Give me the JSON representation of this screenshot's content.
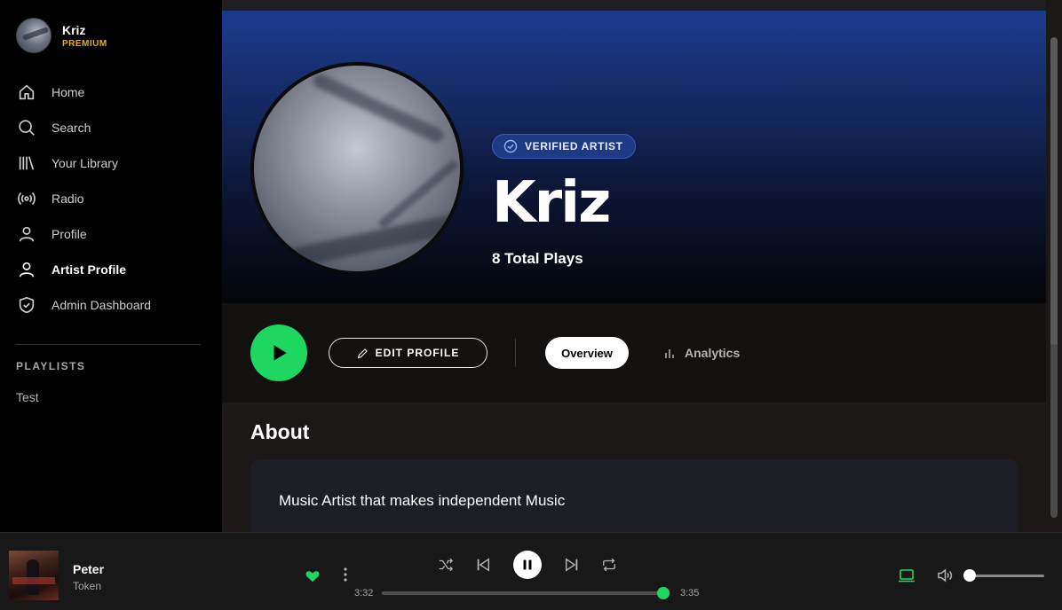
{
  "user": {
    "name": "Kriz",
    "tier": "PREMIUM"
  },
  "nav": [
    {
      "label": "Home",
      "icon": "home-icon",
      "active": false
    },
    {
      "label": "Search",
      "icon": "search-icon",
      "active": false
    },
    {
      "label": "Your Library",
      "icon": "library-icon",
      "active": false
    },
    {
      "label": "Radio",
      "icon": "radio-icon",
      "active": false
    },
    {
      "label": "Profile",
      "icon": "user-icon",
      "active": false
    },
    {
      "label": "Artist Profile",
      "icon": "user-icon",
      "active": true
    },
    {
      "label": "Admin Dashboard",
      "icon": "shield-icon",
      "active": false
    }
  ],
  "playlists": {
    "heading": "PLAYLISTS",
    "items": [
      "Test"
    ]
  },
  "artist": {
    "badge": "VERIFIED ARTIST",
    "name": "Kriz",
    "plays": "8 Total Plays"
  },
  "actions": {
    "edit_label": "EDIT PROFILE",
    "tabs": [
      {
        "label": "Overview",
        "active": true
      },
      {
        "label": "Analytics",
        "active": false
      }
    ]
  },
  "about": {
    "heading": "About",
    "text": "Music Artist that makes independent Music"
  },
  "player": {
    "title": "Peter",
    "artist": "Token",
    "elapsed": "3:32",
    "duration": "3:35",
    "progress": 0.9907,
    "volume": 0.05,
    "liked": true
  },
  "colors": {
    "accent": "#1ed760",
    "premium": "#e7b008",
    "badge_bg": "#1f3a84",
    "hero_top": "#1c3a8e"
  }
}
